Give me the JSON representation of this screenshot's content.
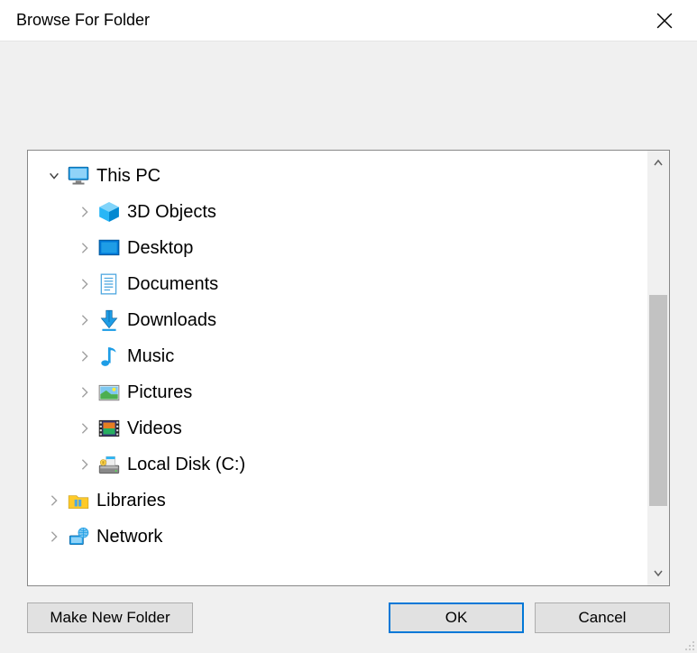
{
  "title": "Browse For Folder",
  "tree": {
    "root": {
      "label": "This PC",
      "expanded": true,
      "children": [
        {
          "label": "3D Objects",
          "icon": "cube"
        },
        {
          "label": "Desktop",
          "icon": "desktop"
        },
        {
          "label": "Documents",
          "icon": "documents"
        },
        {
          "label": "Downloads",
          "icon": "downloads"
        },
        {
          "label": "Music",
          "icon": "music"
        },
        {
          "label": "Pictures",
          "icon": "pictures"
        },
        {
          "label": "Videos",
          "icon": "videos"
        },
        {
          "label": "Local Disk (C:)",
          "icon": "drive"
        }
      ]
    },
    "siblings": [
      {
        "label": "Libraries",
        "icon": "libraries"
      },
      {
        "label": "Network",
        "icon": "network"
      }
    ]
  },
  "buttons": {
    "new_folder": "Make New Folder",
    "ok": "OK",
    "cancel": "Cancel"
  }
}
